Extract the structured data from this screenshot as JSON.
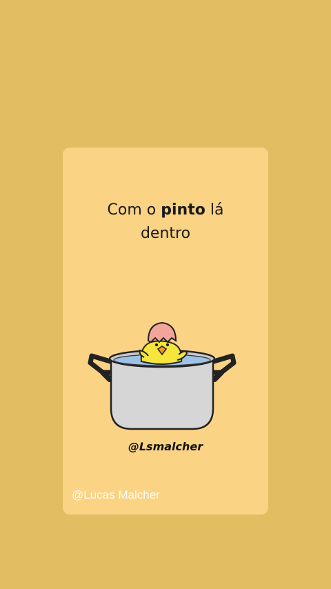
{
  "card": {
    "line1_before": "Com o ",
    "line1_bold": "pinto",
    "line1_after": " lá",
    "line2": "dentro",
    "artist_handle": "@Lsmalcher"
  },
  "watermark": "@Lucas Malcher",
  "colors": {
    "background": "#e2bd62",
    "card": "#fbd384",
    "pot": "#d6d6d6",
    "water": "#9ec2e6",
    "chick": "#f6e53c",
    "eggshell": "#f3a59a"
  }
}
